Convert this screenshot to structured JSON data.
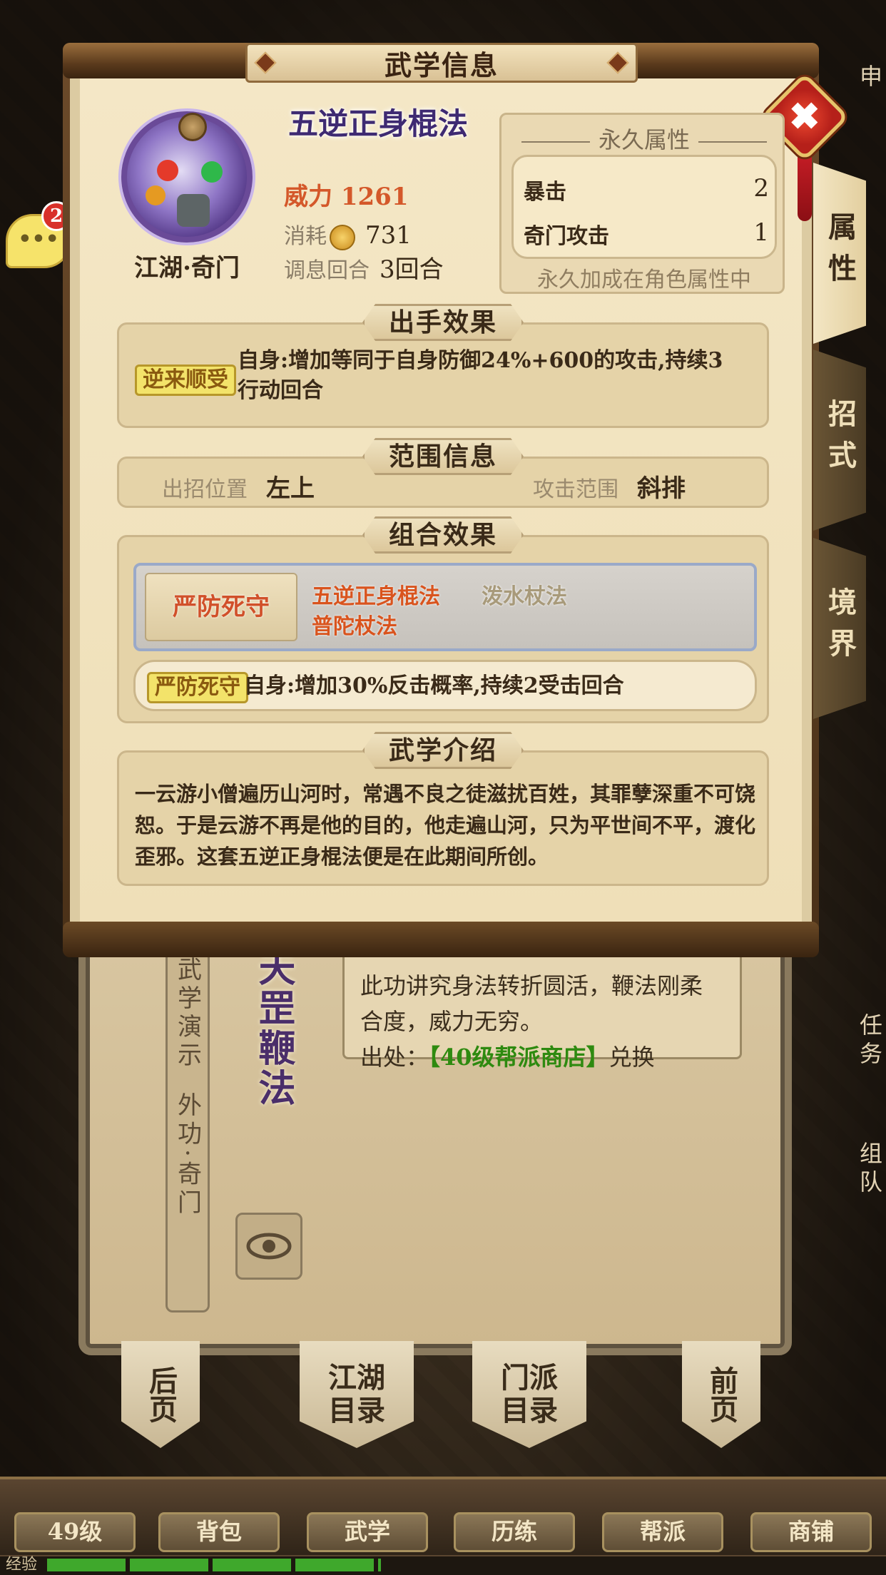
{
  "modal": {
    "title": "武学信息",
    "close_label": "✖",
    "skill": {
      "name": "五逆正身棍法",
      "category": "江湖·奇门",
      "power_label": "威力",
      "power_value": "1261",
      "cost_label": "消耗",
      "cost_value": "731",
      "rest_label": "调息回合",
      "rest_value": "3回合"
    },
    "permanent": {
      "title": "永久属性",
      "rows": [
        {
          "name": "暴击",
          "value": "2"
        },
        {
          "name": "奇门攻击",
          "value": "1"
        }
      ],
      "footer": "永久加成在角色属性中"
    },
    "tabs": [
      {
        "label": "属性",
        "active": true
      },
      {
        "label": "招式",
        "active": false
      },
      {
        "label": "境界",
        "active": false
      }
    ],
    "cast_effect": {
      "header": "出手效果",
      "tag": "逆来顺受",
      "text": "自身:增加等同于自身防御24%+600的攻击,持续3行动回合"
    },
    "range": {
      "header": "范围信息",
      "position_label": "出招位置",
      "position_value": "左上",
      "attack_label": "攻击范围",
      "attack_value": "斜排"
    },
    "combo": {
      "header": "组合效果",
      "card_name": "严防死守",
      "skills": [
        {
          "name": "五逆正身棍法",
          "color": "#d9541e"
        },
        {
          "name": "泼水杖法",
          "color": "#a89a7a"
        },
        {
          "name": "普陀杖法",
          "color": "#d9541e"
        }
      ],
      "effect_tag": "严防死守",
      "effect_text": "自身:增加30%反击概率,持续2受击回合"
    },
    "intro": {
      "header": "武学介绍",
      "text": "一云游小僧遍历山河时，常遇不良之徒滋扰百姓，其罪孽深重不可饶恕。于是云游不再是他的目的，他走遍山河，只为平世间不平，渡化歪邪。这套五逆正身棍法便是在此期间所创。"
    }
  },
  "background": {
    "chat_badge": "2",
    "left_tab_labels": [
      "武学演示",
      "外功·奇门"
    ],
    "vertical_title": "天罡鞭法",
    "desc_line1": "此功讲究身法转折圆活，鞭法刚柔",
    "desc_line2": "合度，威力无穷。",
    "source_label": "出处：",
    "source_shop": "【40级帮派商店】",
    "source_suffix": "兑换",
    "right_tabs": [
      "申",
      "任务",
      "组队"
    ],
    "page_buttons": [
      "后页",
      "江湖目录",
      "门派目录",
      "前页"
    ],
    "menu": [
      "49级",
      "背包",
      "武学",
      "历练",
      "帮派",
      "商铺"
    ],
    "xp_label": "经验",
    "xp_progress": 0.4
  },
  "colors": {
    "accent_orange": "#d4582a",
    "skill_purple": "#3e2a72",
    "tag_yellow": "#f3e36a",
    "close_red": "#d8302a"
  }
}
